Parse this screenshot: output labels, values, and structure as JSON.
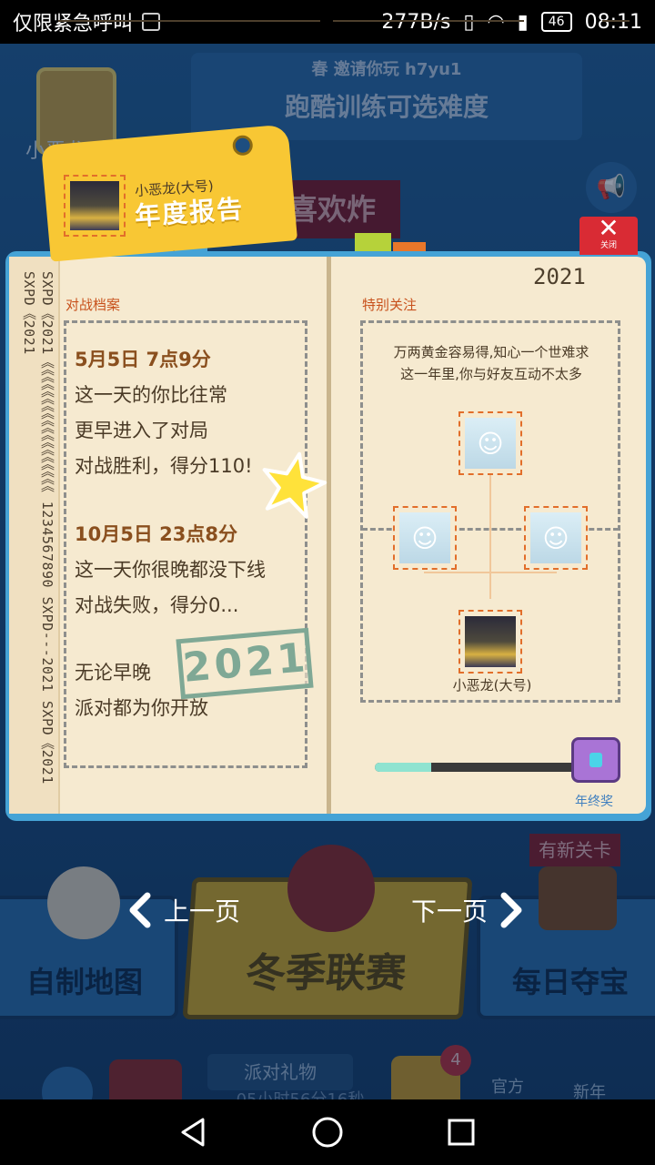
{
  "statusbar": {
    "carrier": "仅限紧急呼叫",
    "speed": "277B/s",
    "battery": "46",
    "time": "08:11"
  },
  "background": {
    "banner_sub": "春 邀请你玩 h7yu1",
    "banner_main": "跑酷训练可选难度",
    "player_name": "小恶龙(大",
    "xihuan": "喜欢炸",
    "tile_left": "自制地图",
    "tile_center": "冬季联赛",
    "tile_right": "每日夺宝",
    "new_level": "有新关卡",
    "gift": "派对礼物",
    "timer": "05小时56分16秒",
    "badge": "4",
    "official": "官方",
    "newyear": "新年"
  },
  "nav": {
    "prev": "上一页",
    "next": "下一页"
  },
  "close": {
    "label": "关闭"
  },
  "report": {
    "tag_name": "小恶龙(大号)",
    "tag_title": "年度报告",
    "left_vertical": "SXPD《2021《《《《《《《《《《《《《《《《《《 1234567890 SXPD---2021 SXPD《2021 SXPD《2021",
    "left_label": "对战档案",
    "story": {
      "a_date": "5月5日 7点9分",
      "a1": "这一天的你比往常",
      "a2": "更早进入了对局",
      "a3": "对战胜利，得分110!",
      "b_date": "10月5日 23点8分",
      "b1": "这一天你很晚都没下线",
      "b2": "对战失败，得分0...",
      "c1": "无论早晚",
      "c2": "派对都为你开放"
    },
    "stamp": "2021",
    "year": "2021",
    "right_label": "特别关注",
    "quote1": "万两黄金容易得,知心一个世难求",
    "quote2": "这一年里,你与好友互动不太多",
    "me_name": "小恶龙(大号)",
    "progress_fraction": 0.28,
    "chest_label": "年终奖"
  },
  "colors": {
    "accent_orange": "#c8511c",
    "tag_yellow": "#f8c734",
    "book_blue": "#45a3d6",
    "close_red": "#d92b34"
  }
}
